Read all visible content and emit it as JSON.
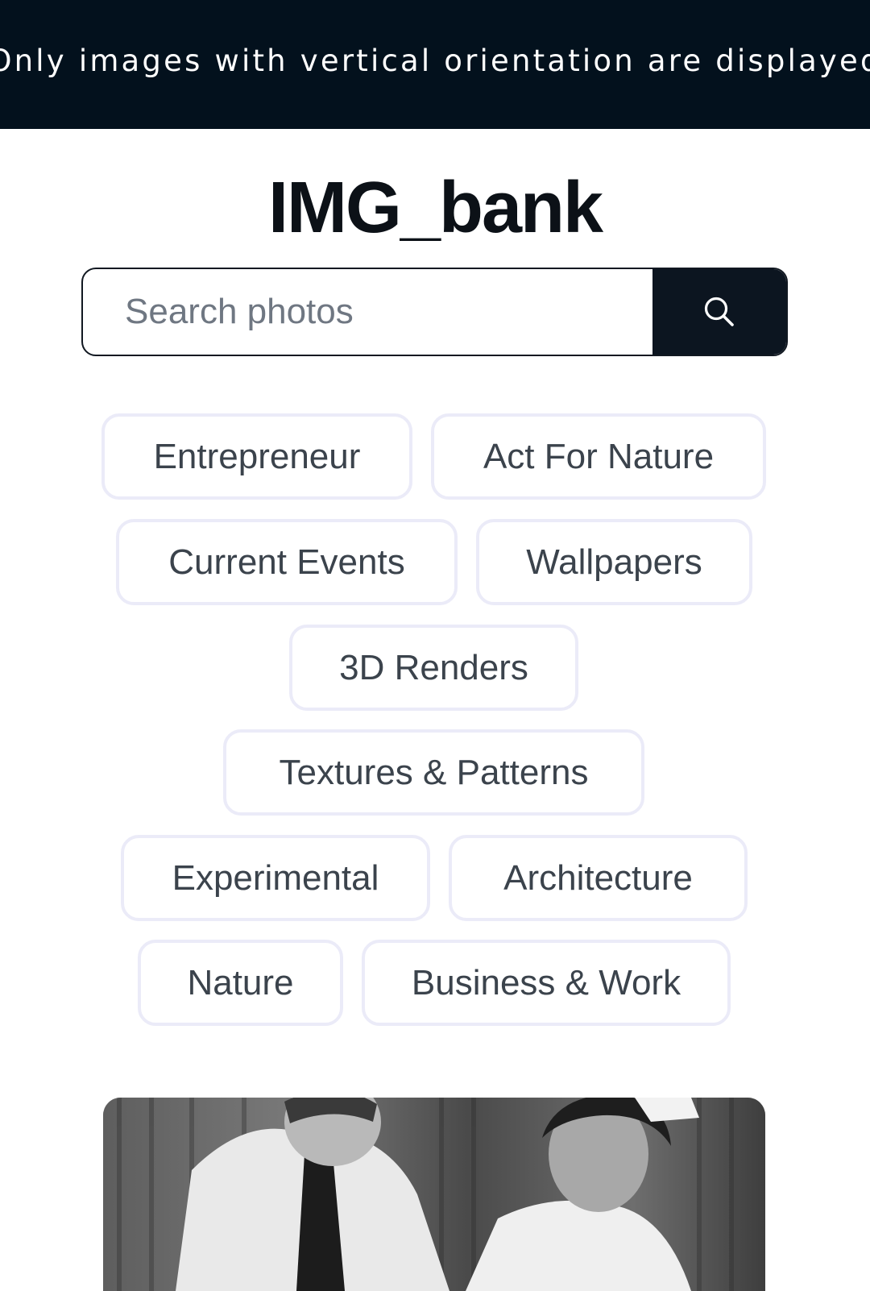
{
  "banner": {
    "text": "Only images with vertical orientation are displayed"
  },
  "header": {
    "logo": "IMG_bank"
  },
  "search": {
    "placeholder": "Search photos",
    "value": "",
    "button_icon": "search-icon"
  },
  "categories": [
    "Entrepreneur",
    "Act For Nature",
    "Current Events",
    "Wallpapers",
    "3D Renders",
    "Textures & Patterns",
    "Experimental",
    "Architecture",
    "Nature",
    "Business & Work"
  ],
  "colors": {
    "banner_bg": "#03111d",
    "search_button_bg": "#0c1520",
    "chip_border": "#ebebf8",
    "text_dark": "#0c1117"
  }
}
